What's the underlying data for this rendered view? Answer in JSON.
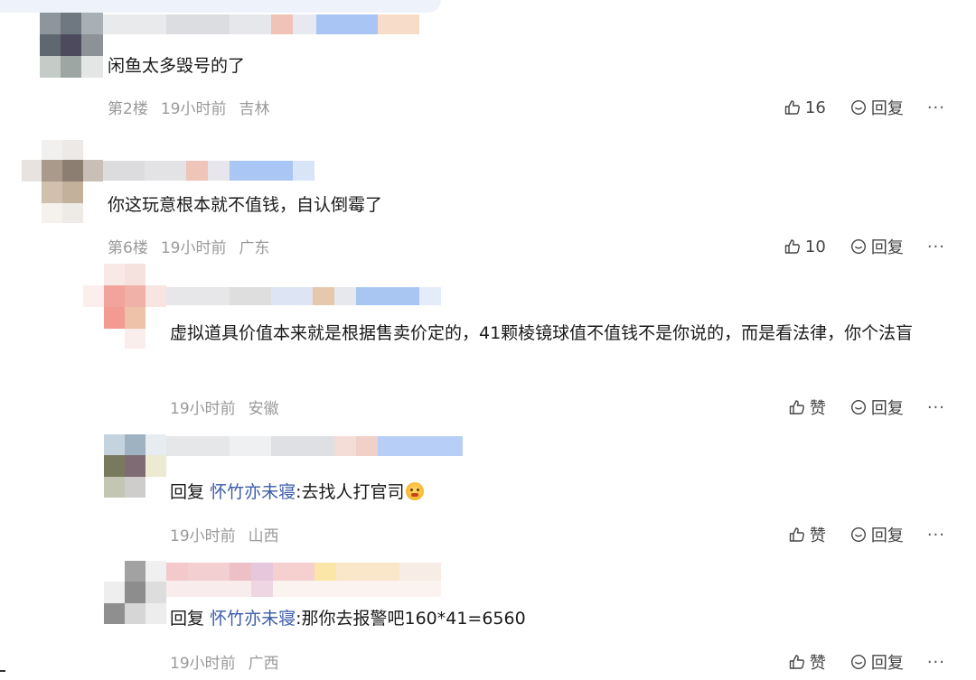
{
  "comments": [
    {
      "text": "闲鱼太多毁号的了",
      "floor": "第2楼",
      "time": "19小时前",
      "location": "吉林",
      "like_label": "16",
      "reply_label": "回复",
      "more_label": "···"
    },
    {
      "text": "你这玩意根本就不值钱，自认倒霉了",
      "floor": "第6楼",
      "time": "19小时前",
      "location": "广东",
      "like_label": "10",
      "reply_label": "回复",
      "more_label": "···"
    }
  ],
  "replies": [
    {
      "text": "虚拟道具价值本来就是根据售卖价定的，41颗棱镜球值不值钱不是你说的，而是看法律，你个法盲",
      "time": "19小时前",
      "location": "安徽",
      "like_label": "赞",
      "reply_label": "回复",
      "more_label": "···"
    },
    {
      "prefix": "回复",
      "target": "怀竹亦未寝",
      "text": ":去找人打官司",
      "time": "19小时前",
      "location": "山西",
      "like_label": "赞",
      "reply_label": "回复",
      "more_label": "···"
    },
    {
      "prefix": "回复",
      "target": "怀竹亦未寝",
      "text": ":那你去报警吧160*41=6560",
      "time": "19小时前",
      "location": "广西",
      "like_label": "赞",
      "reply_label": "回复",
      "more_label": "···"
    }
  ],
  "colors": {
    "meta_gray": "#9a9a9a",
    "reply_link": "#3b5ba9",
    "action_text": "#444444"
  },
  "icons": [
    "thumb-up-icon",
    "reply-bubble-icon",
    "more-icon",
    "angry-emoji-icon"
  ]
}
